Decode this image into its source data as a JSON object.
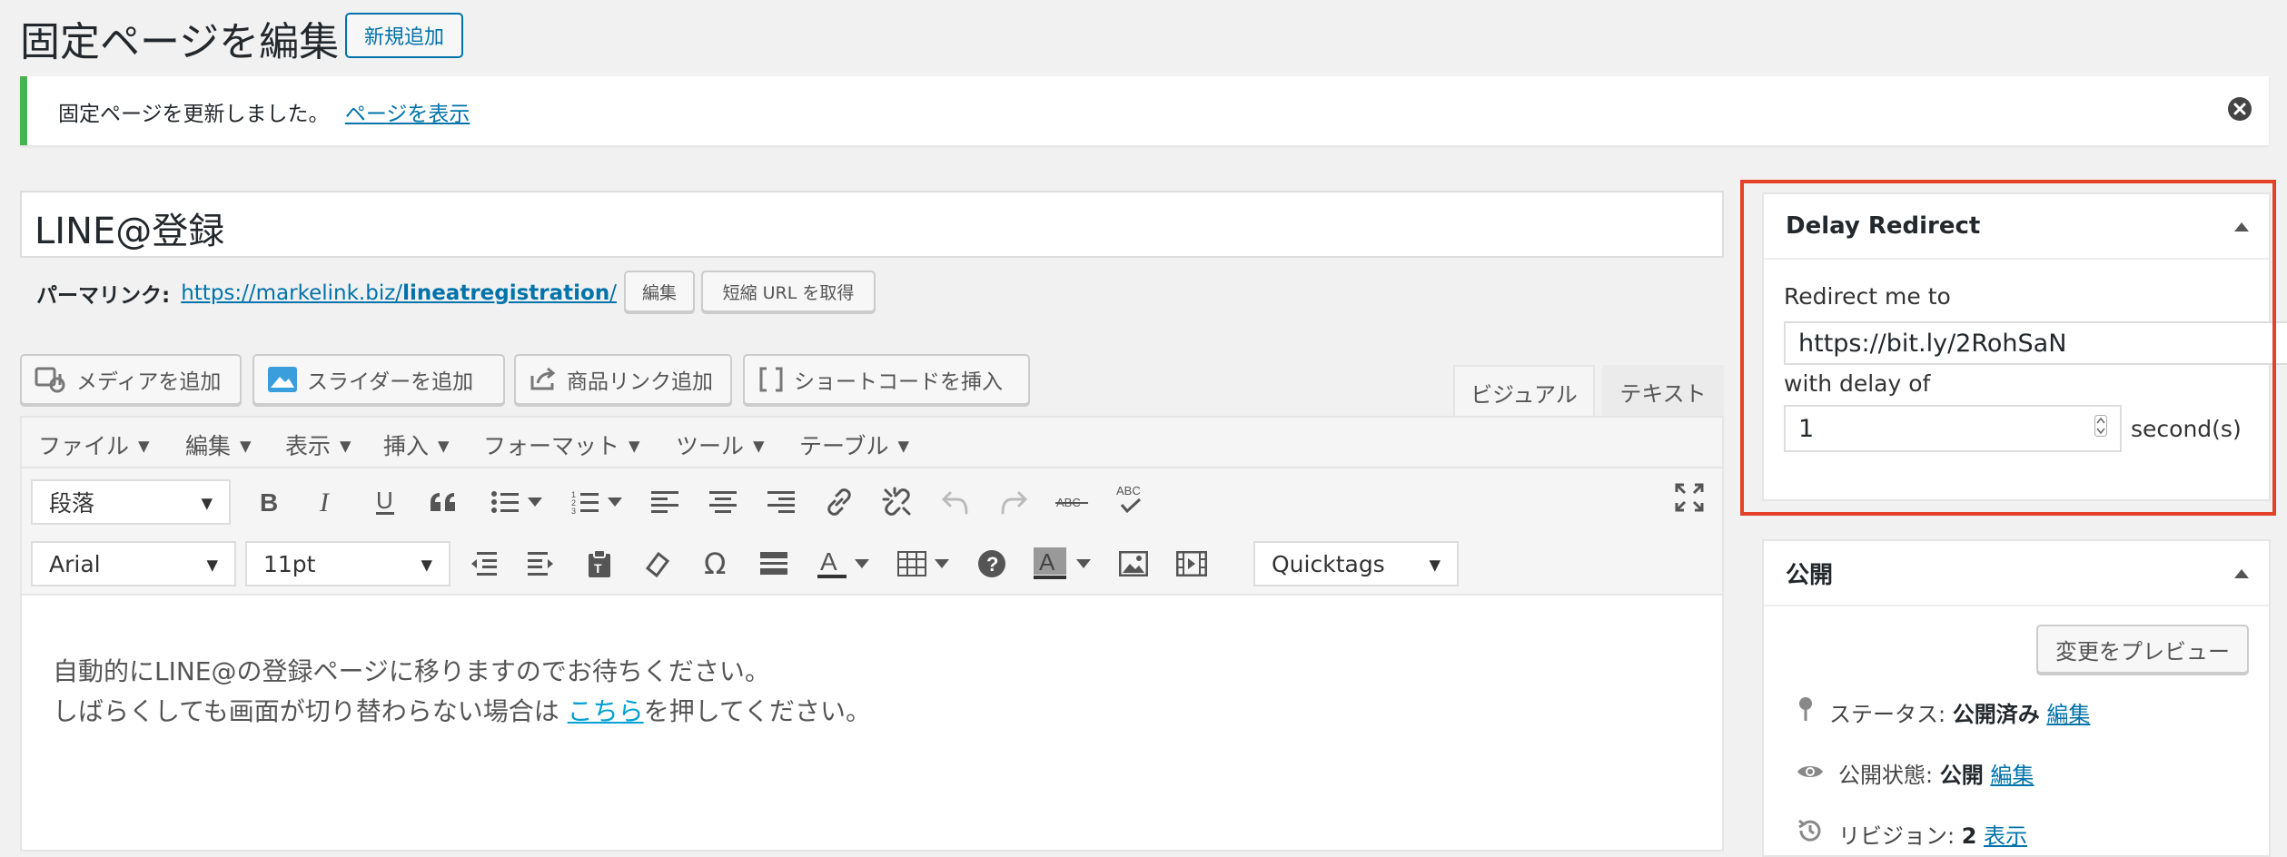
{
  "header": {
    "title": "固定ページを編集",
    "add_new": "新規追加"
  },
  "notice": {
    "message": "固定ページを更新しました。",
    "link": "ページを表示"
  },
  "post": {
    "title": "LINE@登録",
    "permalink_label": "パーマリンク:",
    "permalink_base": "https://markelink.biz/",
    "permalink_slug": "lineatregistration",
    "permalink_trailing": "/",
    "edit_button": "編集",
    "short_url_button": "短縮 URL を取得"
  },
  "media_buttons": [
    {
      "label": "メディアを追加",
      "icon": "media-icon"
    },
    {
      "label": "スライダーを追加",
      "icon": "slider-icon"
    },
    {
      "label": "商品リンク追加",
      "icon": "product-link-icon"
    },
    {
      "label": "ショートコードを挿入",
      "icon": "shortcode-icon"
    }
  ],
  "tabs": {
    "visual": "ビジュアル",
    "text": "テキスト"
  },
  "menubar": [
    "ファイル",
    "編集",
    "表示",
    "挿入",
    "フォーマット",
    "ツール",
    "テーブル"
  ],
  "toolbar": {
    "format": "段落",
    "font_family": "Arial",
    "font_size": "11pt",
    "quicktags": "Quicktags"
  },
  "content": {
    "line1": "自動的にLINE@の登録ページに移りますのでお待ちください。",
    "line2_before": "しばらくしても画面が切り替わらない場合は ",
    "line2_link": "こちら",
    "line2_after": "を押してください。"
  },
  "delay_redirect": {
    "title": "Delay Redirect",
    "redirect_label": "Redirect me to",
    "redirect_value": "https://bit.ly/2RohSaN",
    "delay_label": "with delay of",
    "delay_value": "1",
    "unit": "second(s)"
  },
  "publish": {
    "title": "公開",
    "preview_button": "変更をプレビュー",
    "status_label": "ステータス:",
    "status_value": "公開済み",
    "status_edit": "編集",
    "visibility_label": "公開状態:",
    "visibility_value": "公開",
    "visibility_edit": "編集",
    "revisions_label": "リビジョン:",
    "revisions_value": "2",
    "revisions_link": "表示"
  },
  "colors": {
    "accent": "#0073aa",
    "success": "#46b450",
    "highlight_frame": "#e3412a"
  }
}
